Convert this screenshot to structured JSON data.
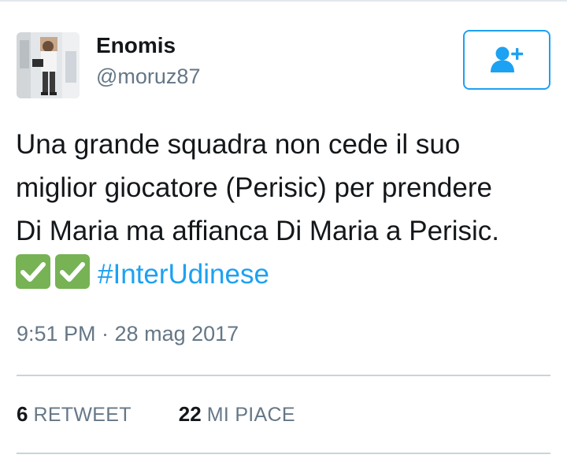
{
  "tweet": {
    "author": {
      "display_name": "Enomis",
      "handle": "@moruz87",
      "avatar_icon": "profile-photo"
    },
    "follow_button": {
      "icon": "add-user-icon",
      "color": "#1da1f2"
    },
    "text_lines": [
      "Una grande squadra non cede il suo",
      "miglior giocatore (Perisic) per prendere",
      "Di Maria ma affianca Di Maria a Perisic."
    ],
    "emojis": [
      "check-mark-button-icon",
      "check-mark-button-icon"
    ],
    "hashtag": "#InterUdinese",
    "timestamp": "9:51 PM · 28 mag 2017",
    "stats": {
      "retweets": {
        "count": "6",
        "label": "RETWEET"
      },
      "likes": {
        "count": "22",
        "label": "MI PIACE"
      }
    }
  },
  "colors": {
    "link": "#1da1f2",
    "text": "#14171a",
    "secondary_text": "#657786",
    "emoji_green": "#77b255"
  }
}
